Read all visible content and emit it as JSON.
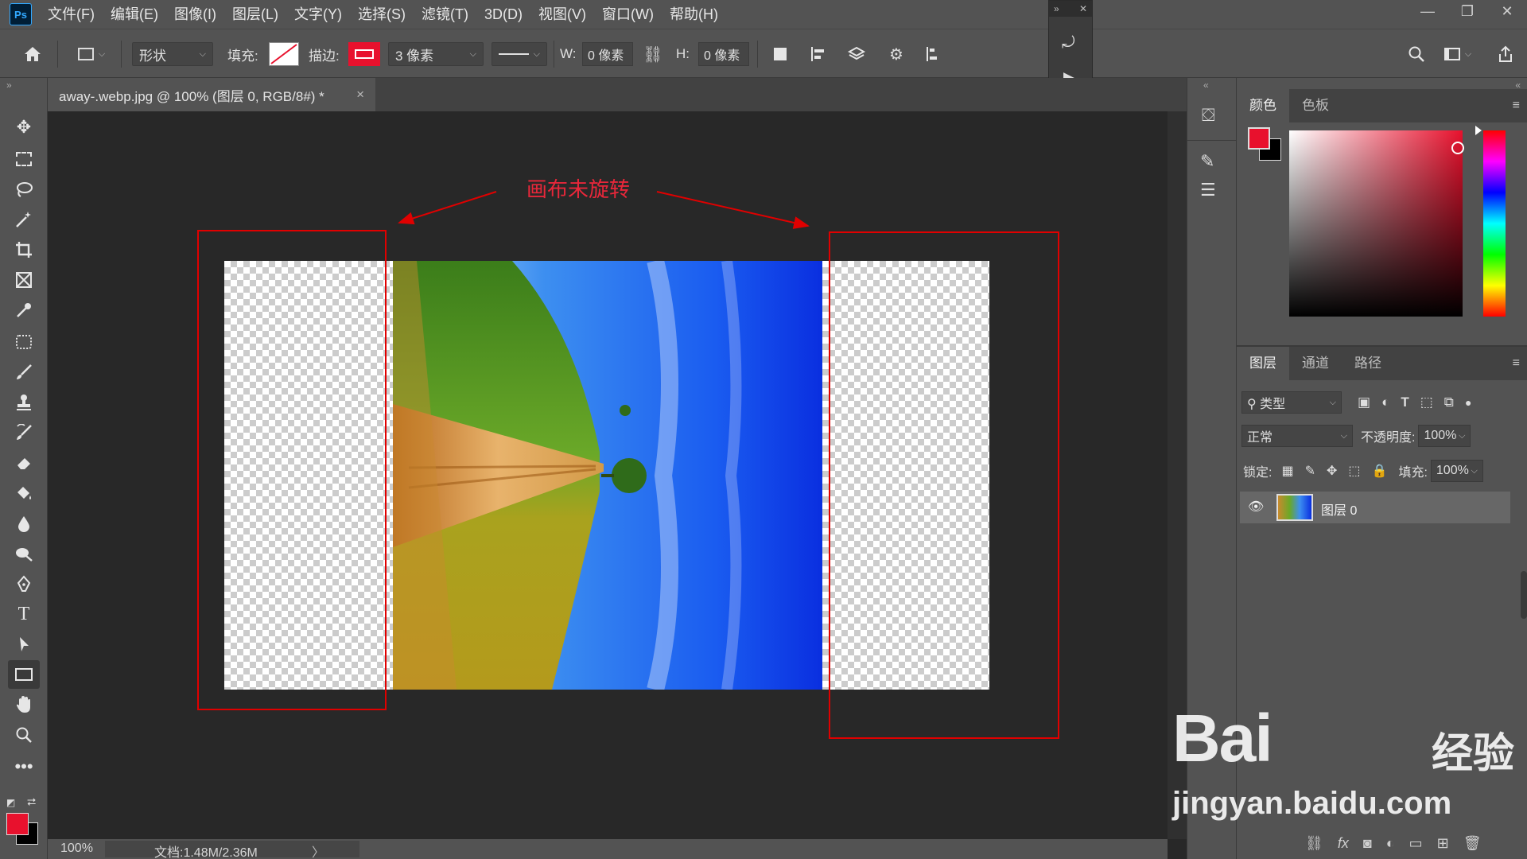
{
  "app": {
    "logo": "Ps"
  },
  "menu": [
    "文件(F)",
    "编辑(E)",
    "图像(I)",
    "图层(L)",
    "文字(Y)",
    "选择(S)",
    "滤镜(T)",
    "3D(D)",
    "视图(V)",
    "窗口(W)",
    "帮助(H)"
  ],
  "options": {
    "mode": "形状",
    "fill_label": "填充:",
    "stroke_label": "描边:",
    "stroke_width": "3 像素",
    "w_label": "W:",
    "w_value": "0 像素",
    "h_label": "H:",
    "h_value": "0 像素"
  },
  "document": {
    "tab_title": "away-.webp.jpg @ 100% (图层 0, RGB/8#) *",
    "close": "×"
  },
  "annotation": {
    "text": "画布未旋转"
  },
  "status": {
    "zoom": "100%",
    "doc_size": "文档:1.48M/2.36M",
    "arrow": "〉"
  },
  "color_panel": {
    "tabs": [
      "颜色",
      "色板"
    ]
  },
  "layers_panel": {
    "tabs": [
      "图层",
      "通道",
      "路径"
    ],
    "filter_kind": "类型",
    "blend_mode": "正常",
    "opacity_label": "不透明度:",
    "opacity_value": "100%",
    "lock_label": "锁定:",
    "fill_label": "填充:",
    "fill_value": "100%",
    "layers": [
      {
        "name": "图层 0"
      }
    ]
  },
  "watermark": {
    "brand": "Bai",
    "brand2": "经验",
    "url": "jingyan.baidu.com"
  },
  "colors": {
    "foreground": "#e8112d",
    "background": "#000000",
    "annotation": "#e00000"
  }
}
